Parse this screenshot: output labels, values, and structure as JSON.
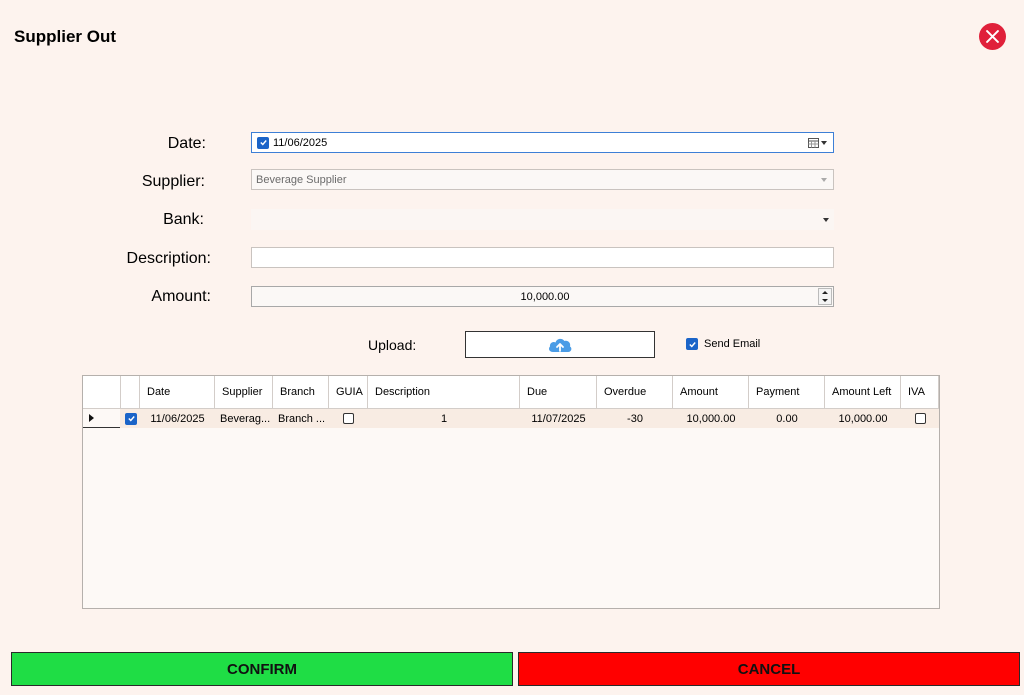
{
  "window": {
    "title": "Supplier Out"
  },
  "form": {
    "date_label": "Date:",
    "date_value": "11/06/2025",
    "supplier_label": "Supplier:",
    "supplier_value": "Beverage Supplier",
    "bank_label": "Bank:",
    "bank_value": "",
    "description_label": "Description:",
    "description_value": "",
    "amount_label": "Amount:",
    "amount_value": "10,000.00"
  },
  "upload": {
    "label": "Upload:",
    "icon": "cloud-upload-icon"
  },
  "send_email": {
    "label": "Send Email",
    "checked": true
  },
  "grid": {
    "columns": [
      "Date",
      "Supplier",
      "Branch",
      "GUIA",
      "Description",
      "Due",
      "Overdue",
      "Amount",
      "Payment",
      "Amount Left",
      "IVA"
    ],
    "rows": [
      {
        "selected": true,
        "date": "11/06/2025",
        "supplier": "Beverag...",
        "branch": "Branch ...",
        "guia": false,
        "description": "1",
        "due": "11/07/2025",
        "overdue": "-30",
        "amount": "10,000.00",
        "payment": "0.00",
        "amount_left": "10,000.00",
        "iva": false
      }
    ]
  },
  "buttons": {
    "confirm": "CONFIRM",
    "cancel": "CANCEL"
  },
  "colors": {
    "confirm": "#1fdd45",
    "cancel": "#ff0000",
    "close": "#e0203a",
    "accent": "#1b64c8"
  }
}
